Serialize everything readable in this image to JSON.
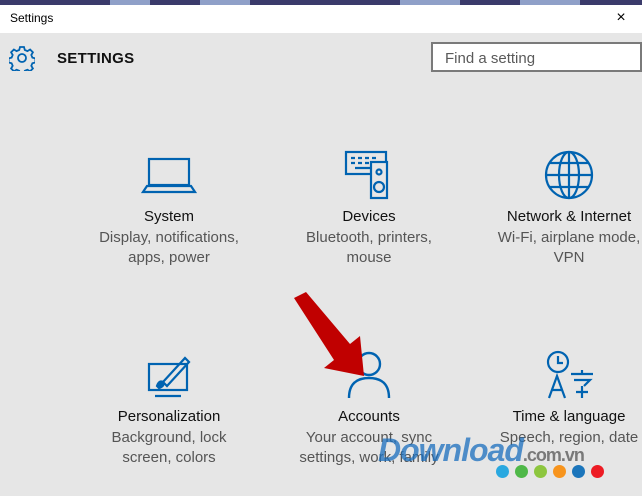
{
  "window": {
    "title": "Settings",
    "close_glyph": "×"
  },
  "header": {
    "title": "SETTINGS",
    "search_placeholder": "Find a setting"
  },
  "tiles": [
    {
      "title": "System",
      "desc1": "Display, notifications,",
      "desc2": "apps, power",
      "icon": "laptop-icon"
    },
    {
      "title": "Devices",
      "desc1": "Bluetooth, printers,",
      "desc2": "mouse",
      "icon": "devices-icon"
    },
    {
      "title": "Network & Internet",
      "desc1": "Wi-Fi, airplane mode,",
      "desc2": "VPN",
      "icon": "globe-icon"
    },
    {
      "title": "Personalization",
      "desc1": "Background, lock",
      "desc2": "screen, colors",
      "icon": "paint-icon"
    },
    {
      "title": "Accounts",
      "desc1": "Your account, sync",
      "desc2": "settings, work, family",
      "icon": "person-icon"
    },
    {
      "title": "Time & language",
      "desc1": "Speech, region, date",
      "desc2": "",
      "icon": "time-language-icon"
    }
  ],
  "watermark": {
    "text": "Download",
    "suffix": ".com.vn"
  },
  "colors": {
    "accent": "#0063b1",
    "arrow": "#c00000",
    "dots": [
      "#29a8e0",
      "#4fb848",
      "#8dc63f",
      "#f7941d",
      "#1b75bb",
      "#ed1c24"
    ]
  }
}
